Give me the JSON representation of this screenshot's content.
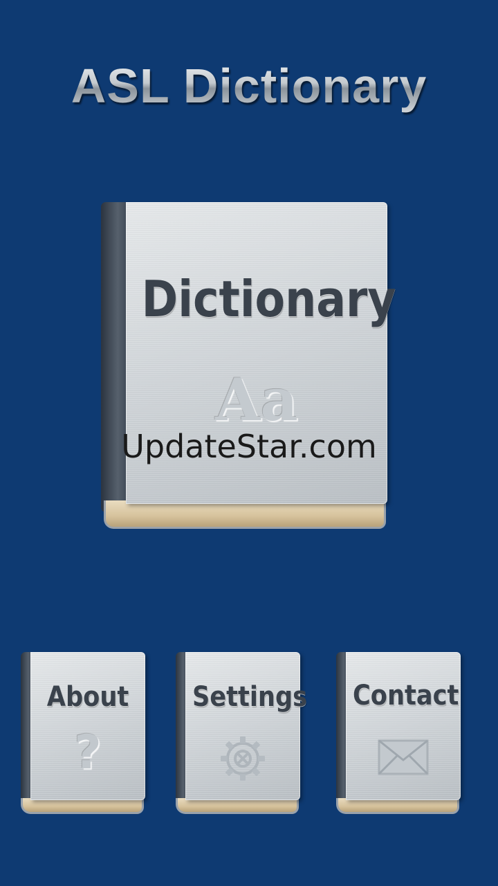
{
  "header": {
    "title": "ASL Dictionary"
  },
  "main_book": {
    "label": "Dictionary",
    "glyph": "Aa"
  },
  "watermark": "UpdateStar.com",
  "menu": {
    "about": {
      "label": "About",
      "icon": "question-mark-icon"
    },
    "settings": {
      "label": "Settings",
      "icon": "gear-icon"
    },
    "contact": {
      "label": "Contact",
      "icon": "envelope-icon"
    }
  },
  "colors": {
    "background": "#0e3a72",
    "cover": "#d2d7db",
    "spine": "#3d4652",
    "text": "#3a424c"
  }
}
